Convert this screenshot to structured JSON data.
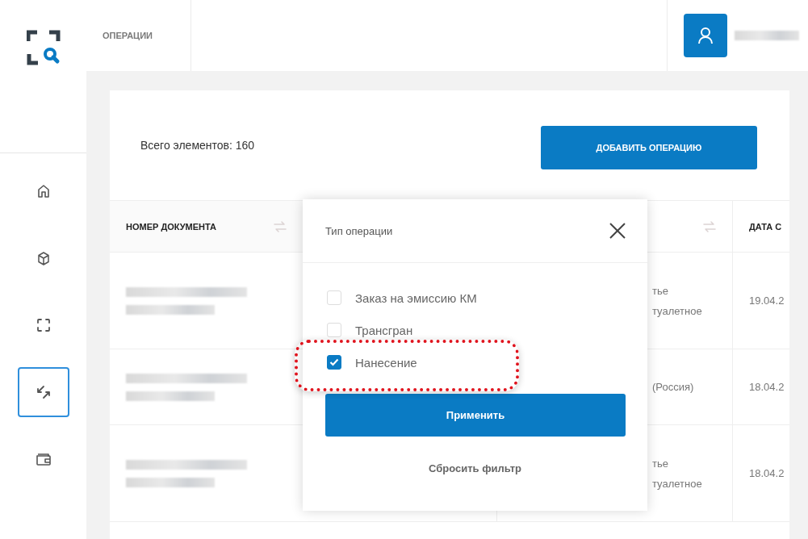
{
  "sidebar": {
    "items": [
      {
        "kind": "home",
        "selected": false
      },
      {
        "kind": "cube",
        "selected": false
      },
      {
        "kind": "frame",
        "selected": false
      },
      {
        "kind": "arrows",
        "selected": true
      },
      {
        "kind": "wallet",
        "selected": false
      }
    ]
  },
  "topbar": {
    "section_title": "ОПЕРАЦИИ"
  },
  "summary": "Всего элементов: 160",
  "add_button": "ДОБАВИТЬ ОПЕРАЦИЮ",
  "table": {
    "columns": [
      {
        "label": "НОМЕР ДОКУМЕНТА",
        "sortable": true
      },
      {
        "sortable": true
      },
      {
        "label": "ДАТА С",
        "sortable": false
      }
    ],
    "rows": [
      {
        "column_3": [
          "тье",
          "туалетное"
        ],
        "column_4": "19.04.2"
      },
      {
        "column_3": [
          "(Россия)"
        ],
        "column_4": "18.04.2"
      },
      {
        "column_3": [
          "тье",
          "туалетное"
        ],
        "column_4": "18.04.2"
      }
    ]
  },
  "filter_popup": {
    "title": "Тип операции",
    "options": [
      {
        "label": "Заказ на эмиссию КМ",
        "checked": false,
        "highlighted": false
      },
      {
        "label": "Трансгран",
        "checked": false,
        "highlighted": false
      },
      {
        "label": "Нанесение",
        "checked": true,
        "highlighted": true
      }
    ],
    "apply_button": "Применить",
    "reset_link": "Сбросить фильтр"
  }
}
